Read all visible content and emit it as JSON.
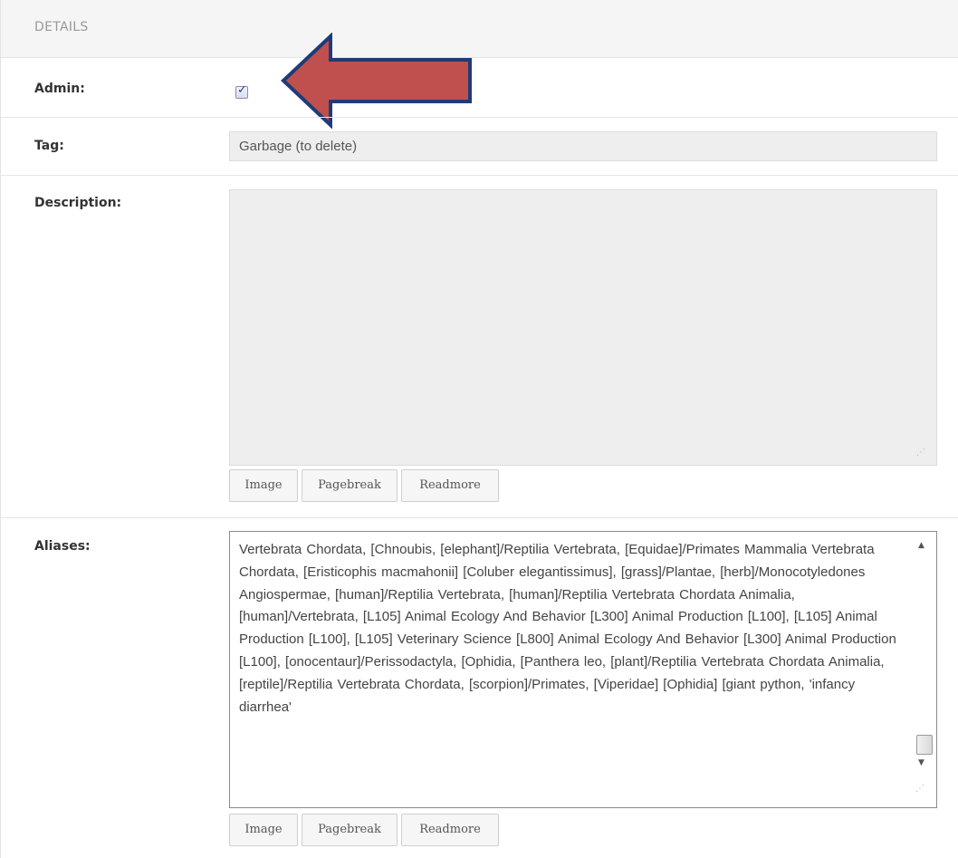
{
  "header": {
    "title": "DETAILS"
  },
  "admin": {
    "label": "Admin:",
    "checked": true,
    "check_glyph": "✓"
  },
  "tag": {
    "label": "Tag:",
    "value": "Garbage (to delete)"
  },
  "description": {
    "label": "Description:",
    "value": "",
    "buttons": [
      "Image",
      "Pagebreak",
      "Readmore"
    ]
  },
  "aliases": {
    "label": "Aliases:",
    "value": "Vertebrata Chordata, [Chnoubis, [elephant]/Reptilia Vertebrata, [Equidae]/Primates Mammalia Vertebrata Chordata, [Eristicophis macmahonii] [Coluber elegantissimus], [grass]/Plantae, [herb]/Monocotyledones Angiospermae, [human]/Reptilia Vertebrata, [human]/Reptilia Vertebrata Chordata Animalia, [human]/Vertebrata, [L105] Animal Ecology And Behavior [L300] Animal Production [L100], [L105] Animal Production [L100], [L105] Veterinary Science [L800] Animal Ecology And Behavior [L300] Animal Production [L100], [onocentaur]/Perissodactyla, [Ophidia, [Panthera leo, [plant]/Reptilia Vertebrata Chordata Animalia, [reptile]/Reptilia Vertebrata Chordata, [scorpion]/Primates, [Viperidae] [Ophidia] [giant python, 'infancy diarrhea'",
    "buttons": [
      "Image",
      "Pagebreak",
      "Readmore"
    ]
  },
  "icons": {
    "pointer_arrow": "red-arrow-icon",
    "scroll_up": "▲",
    "scroll_down": "▼",
    "resize_grip": "⋰"
  },
  "colors": {
    "arrow_fill": "#c0504d",
    "arrow_stroke": "#1f3b7a"
  }
}
